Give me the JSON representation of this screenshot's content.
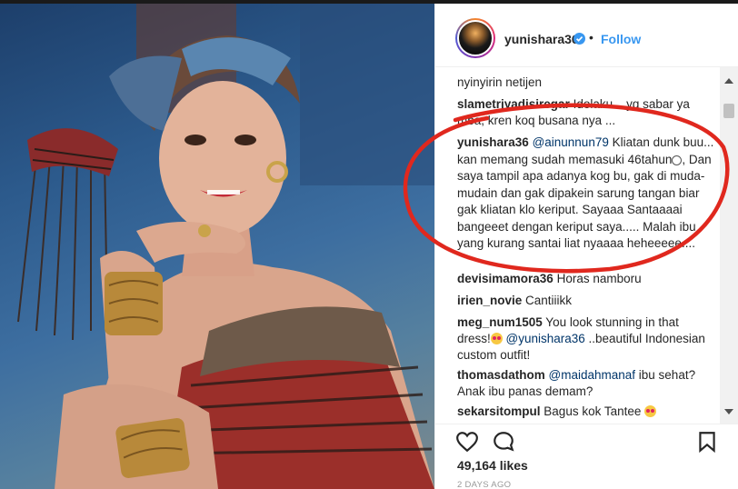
{
  "post": {
    "username": "yunishara36",
    "dot": "•",
    "follow_label": "Follow",
    "likes": "49,164 likes",
    "time": "2 DAYS AGO"
  },
  "comments": [
    {
      "user": "",
      "text": "nyinyirin netijen"
    },
    {
      "user": "slametriyadisiregar",
      "text": " Idolaku .. yg sabar ya mba, kren koq busana nya ..."
    },
    {
      "user": "yunishara36",
      "mention": "@ainunnun79",
      "text": " Kliatan dunk buu... kan memang sudah memasuki 46tahun",
      "text2": ", Dan saya tampil apa adanya kog bu, gak di muda-mudain dan gak dipakein sarung tangan biar gak kliatan klo keriput. Sayaaa Santaaaai bangeeet dengan keriput saya..... Malah ibu yang kurang santai liat nyaaaa heheeeee...."
    },
    {
      "user": "devisimamora36",
      "text": " Horas namboru"
    },
    {
      "user": "irien_novie",
      "text": " Cantiiikk"
    },
    {
      "user": "meg_num1505",
      "text": " You look stunning in that dress!",
      "mention": " @yunishara36",
      "text2": " ..beautiful Indonesian custom outfit!"
    },
    {
      "user": "thomasdathom",
      "mention": " @maidahmanaf",
      "text": " ibu sehat? Anak ibu panas demam?"
    },
    {
      "user": "sekarsitompul",
      "text": " Bagus kok Tantee"
    }
  ],
  "icons": {
    "verified": "verified-badge-icon",
    "heart": "heart-icon",
    "comment": "comment-icon",
    "bookmark": "bookmark-icon"
  },
  "colors": {
    "follow": "#3897f0",
    "annotation": "#e0281e",
    "mention": "#003569"
  }
}
